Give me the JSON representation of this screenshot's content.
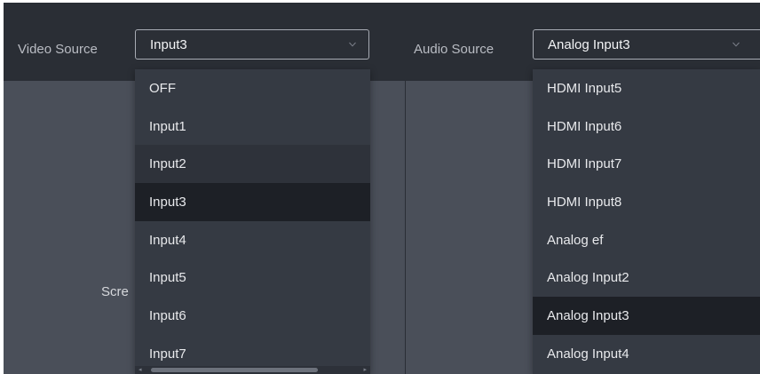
{
  "video": {
    "label": "Video Source",
    "value": "Input3",
    "options": [
      "OFF",
      "Input1",
      "Input2",
      "Input3",
      "Input4",
      "Input5",
      "Input6",
      "Input7"
    ],
    "hover_index": 2,
    "selected_index": 3
  },
  "audio": {
    "label": "Audio Source",
    "value": "Analog Input3",
    "options": [
      "HDMI Input5",
      "HDMI Input6",
      "HDMI Input7",
      "HDMI Input8",
      "Analog ef",
      "Analog Input2",
      "Analog Input3",
      "Analog Input4"
    ],
    "selected_index": 6
  },
  "left_panel": {
    "text": "Scre"
  },
  "icons": {
    "dropdown_chevron": "chevron-down-icon",
    "scroll_left": "scroll-left-arrow-icon",
    "scroll_right": "scroll-right-arrow-icon"
  },
  "colors": {
    "background": "#2e323a",
    "selected_item": "#1d2026",
    "panel": "#4a4f59"
  }
}
